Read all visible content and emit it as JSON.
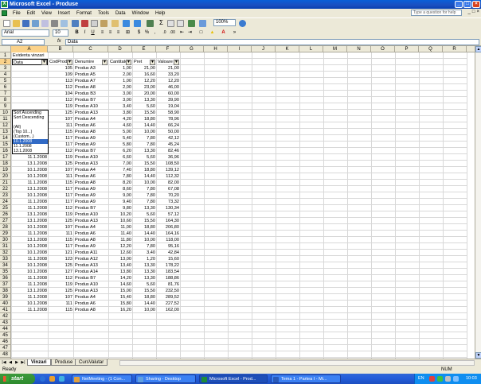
{
  "window": {
    "title": "Microsoft Excel - Produse"
  },
  "menu": [
    "File",
    "Edit",
    "View",
    "Insert",
    "Format",
    "Tools",
    "Data",
    "Window",
    "Help"
  ],
  "ask_placeholder": "Type a question for help",
  "toolbar": {
    "zoom": "100%",
    "font": "Arial",
    "size": "10"
  },
  "formula_bar": {
    "name_box": "A2",
    "fx": "fx",
    "value": "Data"
  },
  "columns": [
    "A",
    "B",
    "C",
    "D",
    "E",
    "F",
    "G",
    "H",
    "I",
    "J",
    "K",
    "L",
    "M",
    "N",
    "O",
    "P",
    "Q",
    "R"
  ],
  "row_numbers": [
    "1",
    "2",
    "3",
    "4",
    "5",
    "6",
    "7",
    "8",
    "9",
    "10",
    "11",
    "12",
    "13",
    "14",
    "15",
    "16",
    "17",
    "18",
    "19",
    "20",
    "21",
    "22",
    "23",
    "24",
    "25",
    "26",
    "27",
    "28",
    "29",
    "30",
    "31",
    "32",
    "33",
    "34",
    "35",
    "36",
    "37",
    "38",
    "39",
    "40",
    "41",
    "42",
    "43",
    "44",
    "45",
    "46",
    "47",
    "48",
    "49"
  ],
  "sheet_title": "Evidenta vinzari",
  "headers": [
    "Data",
    "CodProd",
    "Denumire",
    "Cantitate",
    "Pret",
    "Valoare"
  ],
  "rows": [
    [
      "",
      "105",
      "Produs A3",
      "1,00",
      "21,00",
      "21,00"
    ],
    [
      "",
      "109",
      "Produs A5",
      "2,00",
      "16,60",
      "33,20"
    ],
    [
      "",
      "113",
      "Produs A7",
      "1,00",
      "12,20",
      "12,20"
    ],
    [
      "",
      "112",
      "Produs A8",
      "2,00",
      "23,00",
      "46,00"
    ],
    [
      "",
      "104",
      "Produs B3",
      "3,00",
      "20,00",
      "60,00"
    ],
    [
      "",
      "112",
      "Produs B7",
      "3,00",
      "13,30",
      "39,90"
    ],
    [
      "",
      "119",
      "Produs A10",
      "3,40",
      "5,60",
      "19,04"
    ],
    [
      "13.1.2008",
      "125",
      "Produs A13",
      "3,80",
      "15,50",
      "58,90"
    ],
    [
      "10.1.2008",
      "107",
      "Produs A4",
      "4,20",
      "18,80",
      "78,96"
    ],
    [
      "10.1.2008",
      "111",
      "Produs A6",
      "4,60",
      "14,40",
      "66,24"
    ],
    [
      "13.1.2008",
      "115",
      "Produs A8",
      "5,00",
      "10,00",
      "50,00"
    ],
    [
      "13.1.2008",
      "117",
      "Produs A9",
      "5,40",
      "7,80",
      "42,12"
    ],
    [
      "11.1.2008",
      "117",
      "Produs A9",
      "5,80",
      "7,80",
      "45,24"
    ],
    [
      "13.1.2008",
      "112",
      "Produs B7",
      "6,20",
      "13,30",
      "82,46"
    ],
    [
      "11.1.2008",
      "119",
      "Produs A10",
      "6,60",
      "5,60",
      "36,96"
    ],
    [
      "13.1.2008",
      "125",
      "Produs A13",
      "7,00",
      "15,50",
      "108,50"
    ],
    [
      "10.1.2008",
      "107",
      "Produs A4",
      "7,40",
      "18,80",
      "139,12"
    ],
    [
      "10.1.2008",
      "111",
      "Produs A6",
      "7,80",
      "14,40",
      "112,32"
    ],
    [
      "11.1.2008",
      "115",
      "Produs A8",
      "8,20",
      "10,00",
      "82,00"
    ],
    [
      "13.1.2008",
      "117",
      "Produs A9",
      "8,60",
      "7,80",
      "67,08"
    ],
    [
      "10.1.2008",
      "117",
      "Produs A9",
      "9,00",
      "7,80",
      "70,20"
    ],
    [
      "11.1.2008",
      "117",
      "Produs A9",
      "9,40",
      "7,80",
      "73,32"
    ],
    [
      "11.1.2008",
      "112",
      "Produs B7",
      "9,80",
      "13,30",
      "130,34"
    ],
    [
      "13.1.2008",
      "119",
      "Produs A10",
      "10,20",
      "5,60",
      "57,12"
    ],
    [
      "13.1.2008",
      "125",
      "Produs A13",
      "10,60",
      "15,50",
      "164,30"
    ],
    [
      "10.1.2008",
      "107",
      "Produs A4",
      "11,00",
      "18,80",
      "206,80"
    ],
    [
      "11.1.2008",
      "111",
      "Produs A6",
      "11,40",
      "14,40",
      "164,16"
    ],
    [
      "13.1.2008",
      "115",
      "Produs A8",
      "11,80",
      "10,00",
      "118,00"
    ],
    [
      "10.1.2008",
      "117",
      "Produs A9",
      "12,20",
      "7,80",
      "95,16"
    ],
    [
      "10.1.2008",
      "121",
      "Produs A11",
      "12,60",
      "3,40",
      "42,84"
    ],
    [
      "11.1.2008",
      "123",
      "Produs A12",
      "13,00",
      "1,20",
      "15,60"
    ],
    [
      "10.1.2008",
      "125",
      "Produs A13",
      "13,40",
      "13,30",
      "178,22"
    ],
    [
      "10.1.2008",
      "127",
      "Produs A14",
      "13,80",
      "13,30",
      "183,54"
    ],
    [
      "11.1.2008",
      "112",
      "Produs B7",
      "14,20",
      "13,30",
      "188,86"
    ],
    [
      "11.1.2008",
      "119",
      "Produs A10",
      "14,60",
      "5,60",
      "81,76"
    ],
    [
      "13.1.2008",
      "125",
      "Produs A13",
      "15,00",
      "15,50",
      "232,50"
    ],
    [
      "11.1.2008",
      "107",
      "Produs A4",
      "15,40",
      "18,80",
      "289,52"
    ],
    [
      "10.1.2008",
      "111",
      "Produs A6",
      "15,80",
      "14,40",
      "227,52"
    ],
    [
      "11.1.2008",
      "115",
      "Produs A8",
      "16,20",
      "10,00",
      "162,00"
    ]
  ],
  "dropdown_options": [
    "Sort Ascending",
    "Sort Descending",
    "",
    "(All)",
    "(Top 10...)",
    "(Custom...)",
    "10.1.2008",
    "11.1.2008",
    "13.1.2008"
  ],
  "sheet_tabs": [
    "Vinzari",
    "Produse",
    "CursValutar"
  ],
  "status": {
    "left": "Ready",
    "right": "NUM"
  },
  "taskbar": {
    "start": "start",
    "tasks": [
      "NetMeeting - (1 Con...",
      "Sharing - Desktop",
      "Microsoft Excel - Prod...",
      "Tema 1 - Partea I - Mi..."
    ],
    "lang": "EN",
    "clock": "10:03"
  }
}
